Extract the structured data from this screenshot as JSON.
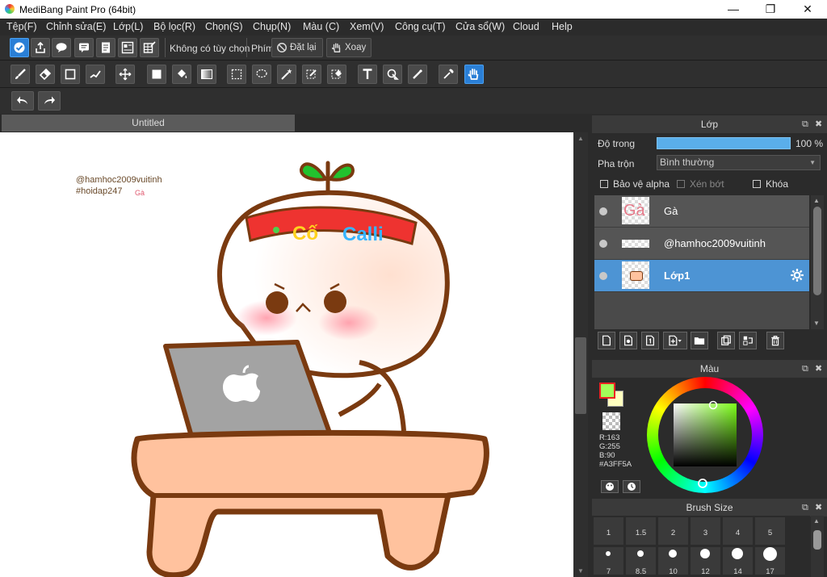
{
  "window": {
    "title": "MediBang Paint Pro (64bit)",
    "minimize": "—",
    "maximize": "❐",
    "close": "✕"
  },
  "menu": [
    {
      "label": "Tệp(F)"
    },
    {
      "label": "Chỉnh sửa(E)"
    },
    {
      "label": "Lớp(L)"
    },
    {
      "label": "Bộ lọc(R)"
    },
    {
      "label": "Chọn(S)"
    },
    {
      "label": "Chụp(N)"
    },
    {
      "label": "Màu (C)"
    },
    {
      "label": "Xem(V)"
    },
    {
      "label": "Công cụ(T)"
    },
    {
      "label": "Cửa sổ(W)"
    },
    {
      "label": "Cloud"
    },
    {
      "label": "Help"
    }
  ],
  "toolbar1": {
    "selection_label": "Không có tùy chọn",
    "key_label": "Phím",
    "reset_label": "Đặt lại",
    "rotate_label": "Xoay"
  },
  "document": {
    "tab_title": "Untitled"
  },
  "canvas_art": {
    "text_line1": "@hamhoc2009vuitinh",
    "text_line2": "#hoidap247",
    "text_ga": "Gà",
    "headband_text1": "Cố",
    "headband_text2": "Calli"
  },
  "layer_panel": {
    "title": "Lớp",
    "float_icon": "⧉",
    "close_icon": "✖",
    "opacity_label": "Độ trong",
    "opacity_value": "100 %",
    "opacity_fraction": 1.0,
    "blend_label": "Pha trộn",
    "blend_value": "Bình thường",
    "protect_alpha": "Bảo vệ alpha",
    "clipping": "Xén bớt",
    "lock": "Khóa",
    "layers": [
      {
        "name": "Gà",
        "visible": true,
        "selected": false
      },
      {
        "name": "@hamhoc2009vuitinh",
        "visible": true,
        "selected": false
      },
      {
        "name": "Lớp1",
        "visible": true,
        "selected": true
      }
    ]
  },
  "color_panel": {
    "title": "Màu",
    "r": "R:163",
    "g": "G:255",
    "b": "B:90",
    "hex": "#A3FF5A",
    "fg_color": "#A3FF5A"
  },
  "brush_panel": {
    "title": "Brush Size",
    "sizes_row1": [
      "1",
      "1.5",
      "2",
      "3",
      "4",
      "5"
    ],
    "sizes_row2": [
      "7",
      "8.5",
      "10",
      "12",
      "14",
      "17"
    ]
  }
}
